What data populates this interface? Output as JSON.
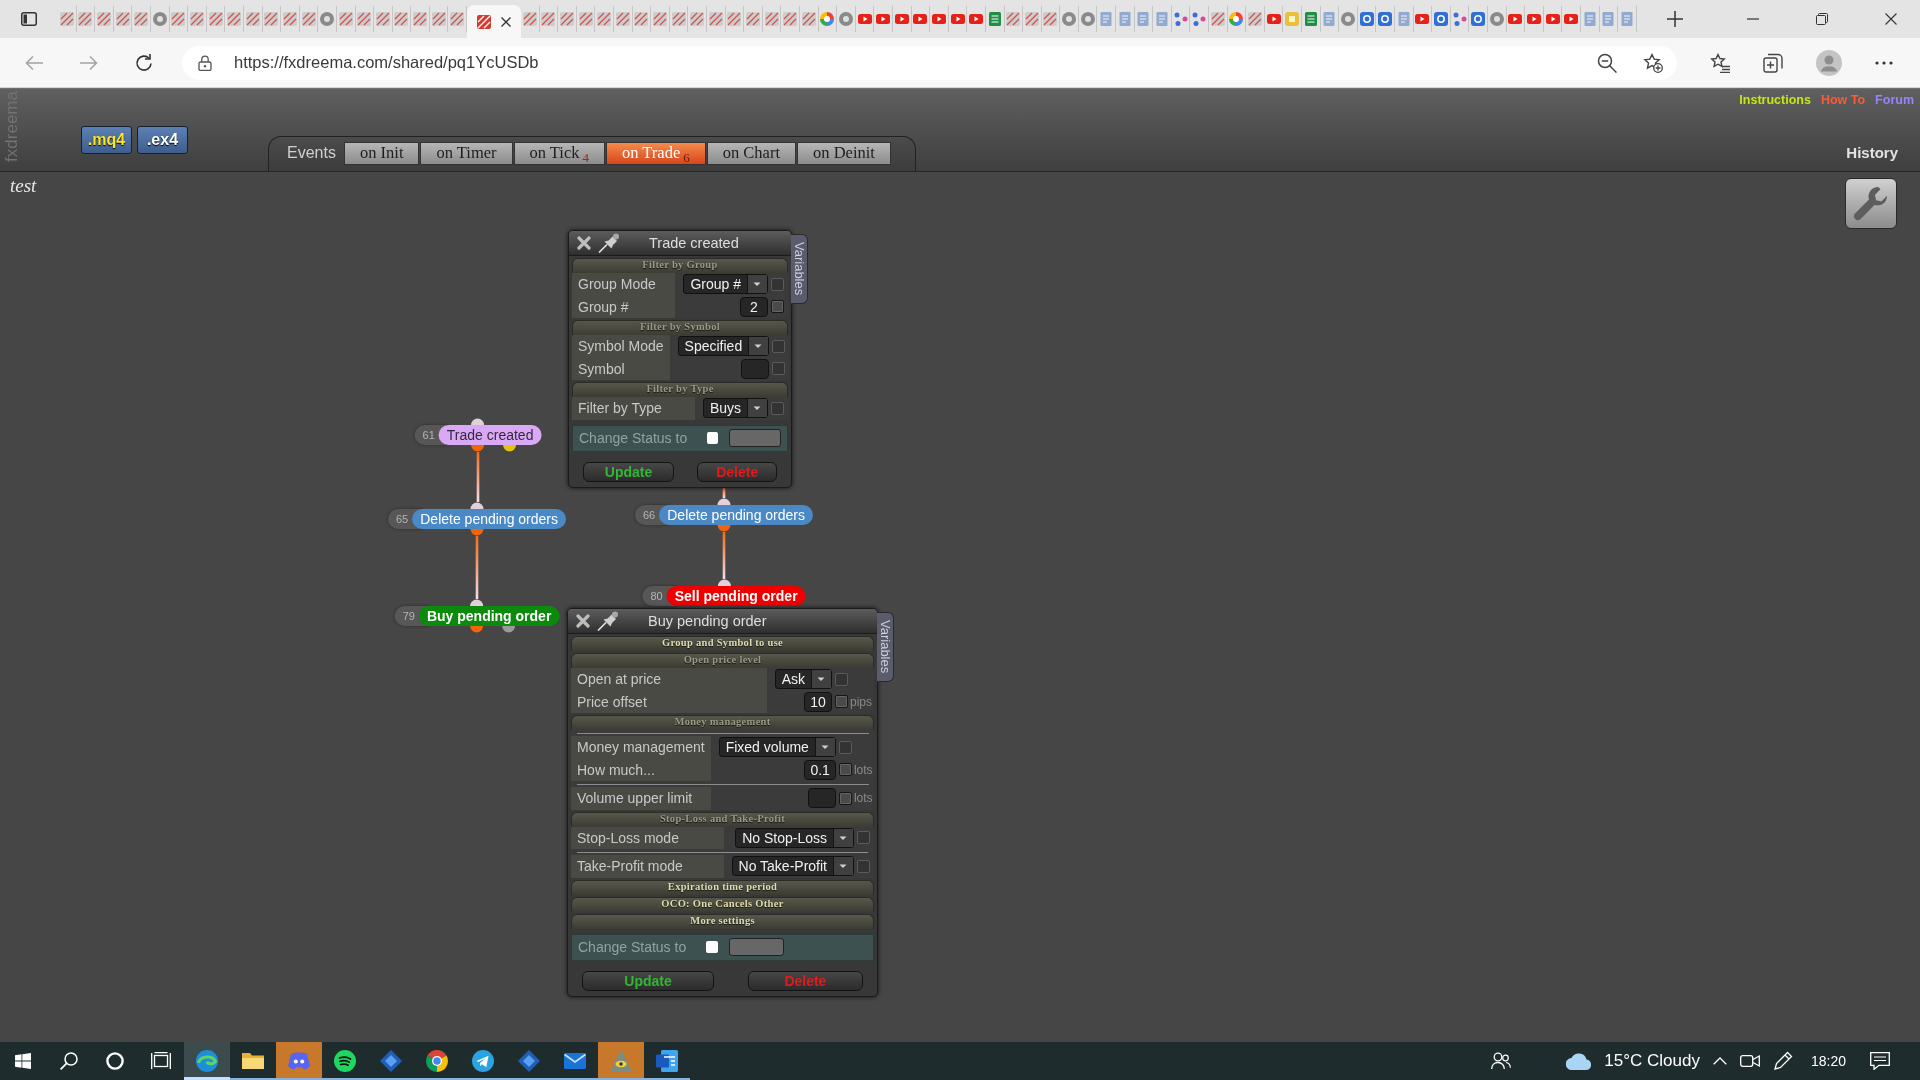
{
  "browser": {
    "tabs": [
      {
        "kind": "fx",
        "selected": false
      },
      {
        "kind": "fx",
        "selected": false
      },
      {
        "kind": "fx",
        "selected": false
      },
      {
        "kind": "fx",
        "selected": false
      },
      {
        "kind": "fx",
        "selected": false
      },
      {
        "kind": "gear",
        "selected": false
      },
      {
        "kind": "fx",
        "selected": false
      },
      {
        "kind": "fx",
        "selected": false
      },
      {
        "kind": "fx",
        "selected": false
      },
      {
        "kind": "fx",
        "selected": false
      },
      {
        "kind": "fx",
        "selected": false
      },
      {
        "kind": "fx",
        "selected": false
      },
      {
        "kind": "fx",
        "selected": false
      },
      {
        "kind": "fx",
        "selected": false
      },
      {
        "kind": "gear",
        "selected": false
      },
      {
        "kind": "fx",
        "selected": false
      },
      {
        "kind": "fx",
        "selected": false
      },
      {
        "kind": "fx",
        "selected": false
      },
      {
        "kind": "fx",
        "selected": false
      },
      {
        "kind": "fx",
        "selected": false
      },
      {
        "kind": "fx",
        "selected": false
      },
      {
        "kind": "fx",
        "selected": false
      },
      {
        "kind": "fxred",
        "selected": true
      },
      {
        "kind": "fx",
        "selected": false
      },
      {
        "kind": "fx",
        "selected": false
      },
      {
        "kind": "fx",
        "selected": false
      },
      {
        "kind": "fx",
        "selected": false
      },
      {
        "kind": "fx",
        "selected": false
      },
      {
        "kind": "fx",
        "selected": false
      },
      {
        "kind": "fx",
        "selected": false
      },
      {
        "kind": "fx",
        "selected": false
      },
      {
        "kind": "fx",
        "selected": false
      },
      {
        "kind": "fx",
        "selected": false
      },
      {
        "kind": "fx",
        "selected": false
      },
      {
        "kind": "fx",
        "selected": false
      },
      {
        "kind": "fx",
        "selected": false
      },
      {
        "kind": "fx",
        "selected": false
      },
      {
        "kind": "fx",
        "selected": false
      },
      {
        "kind": "fx",
        "selected": false
      },
      {
        "kind": "multi",
        "selected": false
      },
      {
        "kind": "gear",
        "selected": false
      },
      {
        "kind": "play",
        "selected": false
      },
      {
        "kind": "play",
        "selected": false
      },
      {
        "kind": "play",
        "selected": false
      },
      {
        "kind": "play",
        "selected": false
      },
      {
        "kind": "play",
        "selected": false
      },
      {
        "kind": "play",
        "selected": false
      },
      {
        "kind": "play",
        "selected": false
      },
      {
        "kind": "sheet",
        "selected": false
      },
      {
        "kind": "fx",
        "selected": false
      },
      {
        "kind": "fx",
        "selected": false
      },
      {
        "kind": "fx",
        "selected": false
      },
      {
        "kind": "gear",
        "selected": false
      },
      {
        "kind": "gear",
        "selected": false
      },
      {
        "kind": "doc",
        "selected": false
      },
      {
        "kind": "doc",
        "selected": false
      },
      {
        "kind": "doc",
        "selected": false
      },
      {
        "kind": "doc",
        "selected": false
      },
      {
        "kind": "dots",
        "selected": false
      },
      {
        "kind": "dots",
        "selected": false
      },
      {
        "kind": "fx",
        "selected": false
      },
      {
        "kind": "multi",
        "selected": false
      },
      {
        "kind": "fx",
        "selected": false
      },
      {
        "kind": "play",
        "selected": false
      },
      {
        "kind": "yellow",
        "selected": false
      },
      {
        "kind": "sheet",
        "selected": false
      },
      {
        "kind": "doc",
        "selected": false
      },
      {
        "kind": "gear",
        "selected": false
      },
      {
        "kind": "blue",
        "selected": false
      },
      {
        "kind": "blue",
        "selected": false
      },
      {
        "kind": "doc",
        "selected": false
      },
      {
        "kind": "play",
        "selected": false
      },
      {
        "kind": "blue",
        "selected": false
      },
      {
        "kind": "dots",
        "selected": false
      },
      {
        "kind": "blue",
        "selected": false
      },
      {
        "kind": "gear",
        "selected": false
      },
      {
        "kind": "play",
        "selected": false
      },
      {
        "kind": "play",
        "selected": false
      },
      {
        "kind": "play",
        "selected": false
      },
      {
        "kind": "play",
        "selected": false
      },
      {
        "kind": "doc",
        "selected": false
      },
      {
        "kind": "doc",
        "selected": false
      },
      {
        "kind": "doc",
        "selected": false
      }
    ],
    "url": "https://fxdreema.com/shared/pq1YcUSDb"
  },
  "header": {
    "brand": "fxdreema",
    "exports": [
      {
        "label": ".mq4",
        "selected": true
      },
      {
        "label": ".ex4",
        "selected": false
      }
    ],
    "events_label": "Events",
    "event_tabs": [
      {
        "label": "on Init",
        "selected": false
      },
      {
        "label": "on Timer",
        "selected": false
      },
      {
        "label": "on Tick",
        "count": "4",
        "selected": false
      },
      {
        "label": "on Trade",
        "count": "6",
        "selected": true
      },
      {
        "label": "on Chart",
        "selected": false
      },
      {
        "label": "on Deinit",
        "selected": false
      }
    ],
    "links": [
      {
        "label": "Instructions",
        "color": "#c8e614"
      },
      {
        "label": "How To",
        "color": "#ff5a32"
      },
      {
        "label": "Forum",
        "color": "#9a82ff"
      }
    ],
    "history": "History"
  },
  "project": {
    "name": "test"
  },
  "nodes": [
    {
      "number": "61",
      "label": "Trade created",
      "kind": "event",
      "color": "#d9a9f5",
      "outputs": [
        {
          "color": "#f0640a"
        },
        {
          "color": "#e6c20c"
        }
      ]
    },
    {
      "number": "65",
      "label": "Delete pending orders",
      "kind": "action",
      "color": "#4a88c6",
      "outputs": [
        {
          "color": "#f0640a"
        }
      ]
    },
    {
      "number": "79",
      "label": "Buy pending order",
      "kind": "trade",
      "color": "#0c8a0c",
      "outputs": [
        {
          "color": "#f0640a"
        },
        {
          "color": "#9a9a9a"
        }
      ]
    },
    {
      "number": "66",
      "label": "Delete pending orders",
      "kind": "action",
      "color": "#4a88c6",
      "outputs": [
        {
          "color": "#f0640a"
        }
      ]
    },
    {
      "number": "80",
      "label": "Sell pending order",
      "kind": "trade",
      "color": "#ee0000"
    }
  ],
  "panels": [
    {
      "title": "Trade created",
      "side_tab": "Variables",
      "sections": [
        {
          "title": "Filter by Group",
          "expanded": true,
          "rows": [
            {
              "kind": "select",
              "label": "Group Mode",
              "value": "Group #",
              "checked": false,
              "check_disabled": true,
              "divider": false
            },
            {
              "kind": "input",
              "label": "Group #",
              "value": "2",
              "checked": false,
              "check_disabled": false,
              "divider": false
            }
          ]
        },
        {
          "title": "Filter by Symbol",
          "expanded": true,
          "rows": [
            {
              "kind": "select",
              "label": "Symbol Mode",
              "value": "Specified",
              "checked": false,
              "check_disabled": true,
              "divider": false
            },
            {
              "kind": "input",
              "label": "Symbol",
              "checked": false,
              "check_disabled": true,
              "divider": false
            }
          ]
        },
        {
          "title": "Filter by Type",
          "expanded": true,
          "rows": [
            {
              "kind": "select",
              "label": "Filter by Type",
              "value": "Buys",
              "checked": false,
              "check_disabled": true,
              "divider": false
            }
          ]
        }
      ],
      "status": {
        "label": "Change Status to",
        "checked": false
      },
      "buttons": [
        {
          "kind": "update",
          "label": "Update"
        },
        {
          "kind": "delete",
          "label": "Delete"
        }
      ]
    },
    {
      "title": "Buy pending order",
      "side_tab": "Variables",
      "sections": [
        {
          "title": "Group and Symbol to use",
          "expanded": false
        },
        {
          "title": "Open price level",
          "expanded": true,
          "rows": [
            {
              "kind": "select",
              "label": "Open at price",
              "value": "Ask",
              "checked": false,
              "check_disabled": true,
              "divider": false
            },
            {
              "kind": "input",
              "label": "Price offset",
              "value": "10",
              "unit": "pips",
              "checked": false,
              "check_disabled": false,
              "divider": false
            }
          ]
        },
        {
          "title": "Money management",
          "expanded": true,
          "rows": [
            {
              "kind": "select",
              "label": "Money management",
              "value": "Fixed volume",
              "checked": false,
              "check_disabled": true,
              "divider": true
            },
            {
              "kind": "input",
              "label": "How much...",
              "value": "0.1",
              "unit": "lots",
              "checked": false,
              "check_disabled": false,
              "divider": false
            },
            {
              "kind": "input",
              "label": "Volume upper limit",
              "unit": "lots",
              "checked": false,
              "check_disabled": false,
              "divider": true
            }
          ]
        },
        {
          "title": "Stop-Loss and Take-Profit",
          "expanded": true,
          "rows": [
            {
              "kind": "select",
              "label": "Stop-Loss mode",
              "value": "No Stop-Loss",
              "checked": false,
              "check_disabled": true,
              "divider": false
            },
            {
              "kind": "select",
              "label": "Take-Profit mode",
              "value": "No Take-Profit",
              "checked": false,
              "check_disabled": true,
              "divider": true
            }
          ]
        },
        {
          "title": "Expiration time period",
          "expanded": false
        },
        {
          "title": "OCO: One Cancels Other",
          "expanded": false
        },
        {
          "title": "More settings",
          "expanded": false
        }
      ],
      "status": {
        "label": "Change Status to",
        "checked": false
      },
      "buttons": [
        {
          "kind": "update",
          "label": "Update"
        },
        {
          "kind": "delete",
          "label": "Delete"
        }
      ]
    }
  ],
  "taskbar": {
    "apps": [
      {
        "kind": "edge",
        "selected": true,
        "flashing": false,
        "running": true
      },
      {
        "kind": "explorer",
        "selected": false,
        "flashing": false,
        "running": true
      },
      {
        "kind": "discord",
        "selected": false,
        "flashing": true,
        "running": true
      },
      {
        "kind": "spotify",
        "selected": false,
        "flashing": false,
        "running": true
      },
      {
        "kind": "diamond",
        "selected": false,
        "flashing": false,
        "running": true
      },
      {
        "kind": "chrome",
        "selected": false,
        "flashing": false,
        "running": true
      },
      {
        "kind": "telegram",
        "selected": false,
        "flashing": false,
        "running": true
      },
      {
        "kind": "diamond",
        "selected": false,
        "flashing": false,
        "running": true
      },
      {
        "kind": "mail",
        "selected": false,
        "flashing": false,
        "running": true
      },
      {
        "kind": "pyramid",
        "selected": false,
        "flashing": true,
        "running": true
      },
      {
        "kind": "word",
        "selected": false,
        "flashing": false,
        "running": true
      }
    ],
    "weather": "15°C Cloudy",
    "clock": "18:20"
  }
}
